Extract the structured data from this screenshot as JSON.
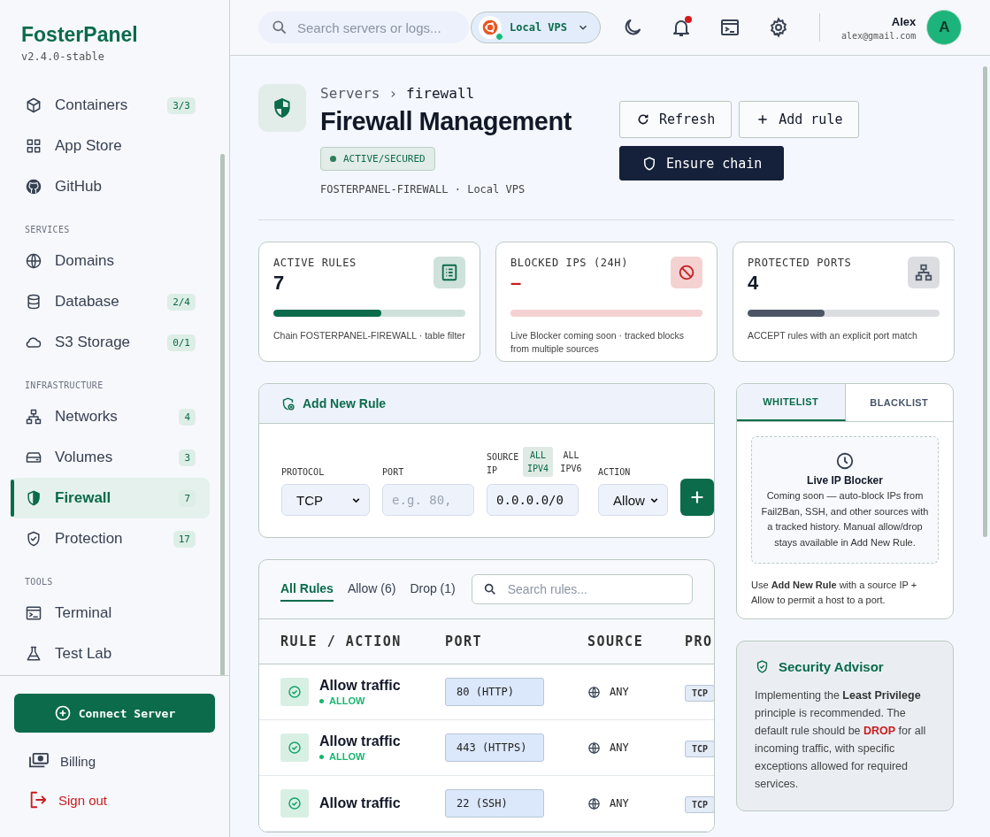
{
  "sidebar": {
    "brand": "FosterPanel",
    "version": "v2.4.0-stable",
    "sections": [
      {
        "items": [
          {
            "label": "Containers",
            "badge": "3/3",
            "selected": false
          },
          {
            "label": "App Store",
            "selected": false
          },
          {
            "label": "GitHub",
            "selected": false
          }
        ]
      },
      {
        "label": "SERVICES",
        "items": [
          {
            "label": "Domains",
            "selected": false
          },
          {
            "label": "Database",
            "badge": "2/4",
            "selected": false
          },
          {
            "label": "S3 Storage",
            "badge": "0/1",
            "selected": false
          }
        ]
      },
      {
        "label": "INFRASTRUCTURE",
        "items": [
          {
            "label": "Networks",
            "badge": "4",
            "selected": false
          },
          {
            "label": "Volumes",
            "badge": "3",
            "selected": false
          },
          {
            "label": "Firewall",
            "badge": "7",
            "selected": true
          },
          {
            "label": "Protection",
            "badge": "17",
            "selected": false
          }
        ]
      },
      {
        "label": "TOOLS",
        "items": [
          {
            "label": "Terminal",
            "selected": false
          },
          {
            "label": "Test Lab",
            "selected": false
          }
        ]
      }
    ],
    "connect_button": "Connect Server",
    "billing": "Billing",
    "sign_out": "Sign out"
  },
  "topbar": {
    "search_placeholder": "Search servers or logs...",
    "server": {
      "name": "Local VPS",
      "online": true
    },
    "notification_dot": true,
    "user": {
      "name": "Alex",
      "email": "alex@gmail.com",
      "initial": "A"
    }
  },
  "page": {
    "breadcrumb": {
      "parent": "Servers",
      "separator": "›",
      "current": "firewall"
    },
    "title": "Firewall Management",
    "status": "ACTIVE/SECURED",
    "subtitle": "FOSTERPANEL-FIREWALL · Local VPS",
    "buttons": [
      {
        "label": "Refresh",
        "kind": "refresh"
      },
      {
        "label": "Add rule",
        "kind": "add"
      },
      {
        "label": "Ensure chain",
        "kind": "primary"
      }
    ]
  },
  "stats": [
    {
      "label": "ACTIVE RULES",
      "value": "7",
      "kind": "count",
      "color": "#0b6b4a",
      "level": 0.56,
      "note": "Chain FOSTERPANEL-FIREWALL · table filter"
    },
    {
      "label": "BLOCKED IPS (24H)",
      "value": "–",
      "kind": "pending",
      "color": "#c81e1e",
      "note": "Live Blocker coming soon · tracked blocks from multiple sources"
    },
    {
      "label": "PROTECTED PORTS",
      "value": "4",
      "kind": "count",
      "color": "#4b5563",
      "level": 0.4,
      "note": "ACCEPT rules with an explicit port match"
    }
  ],
  "add_rule": {
    "title": "Add New Rule",
    "protocol": {
      "label": "PROTOCOL",
      "value": "TCP"
    },
    "port": {
      "label": "PORT",
      "placeholder": "e.g. 80,"
    },
    "source": {
      "label": "SOURCE IP",
      "options": [
        {
          "label": "ALL IPV4",
          "selected": true
        },
        {
          "label": "ALL IPV6",
          "selected": false
        }
      ],
      "value": "0.0.0.0/0"
    },
    "action": {
      "label": "ACTION",
      "value": "Allow"
    }
  },
  "rules": {
    "tabs": [
      {
        "label": "All Rules",
        "selected": true
      },
      {
        "label": "Allow (6)",
        "selected": false
      },
      {
        "label": "Drop (1)",
        "selected": false
      }
    ],
    "search_placeholder": "Search rules...",
    "columns": [
      "RULE / ACTION",
      "PORT",
      "SOURCE"
    ],
    "column_4": "PRO",
    "rows": [
      {
        "name": "Allow traffic",
        "kind": "allow",
        "action": "ALLOW",
        "port": "80 (HTTP)",
        "source": "ANY",
        "protocol": "TCP"
      },
      {
        "name": "Allow traffic",
        "kind": "allow",
        "action": "ALLOW",
        "port": "443 (HTTPS)",
        "source": "ANY",
        "protocol": "TCP"
      },
      {
        "name": "Allow traffic",
        "kind": "allow",
        "port": "22 (SSH)",
        "source": "ANY",
        "protocol": "TCP"
      }
    ]
  },
  "lists_panel": {
    "tabs": [
      {
        "label": "WHITELIST",
        "selected": true
      },
      {
        "label": "BLACKLIST",
        "selected": false
      }
    ],
    "blocker": {
      "title": "Live IP Blocker",
      "text": "Coming soon — auto-block IPs from Fail2Ban, SSH, and other sources with a tracked history. Manual allow/drop stays available in Add New Rule."
    },
    "note": "Use **Add New Rule** with a source IP + Allow to permit a host to a port."
  },
  "advisor": {
    "title": "Security Advisor",
    "text": "Implementing the **Least Privilege** principle is recommended. The default rule should be **DROP** for all incoming traffic, with specific exceptions allowed for required services."
  }
}
